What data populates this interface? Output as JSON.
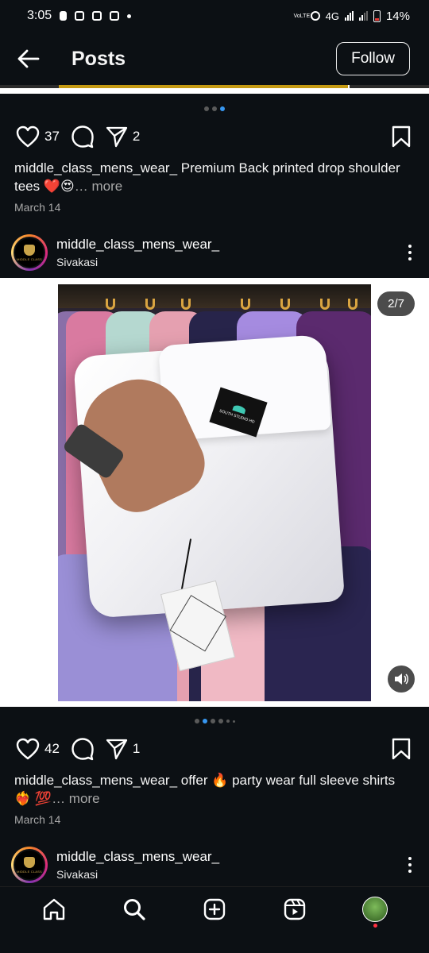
{
  "status_bar": {
    "time": "3:05",
    "network": "VoLTE1",
    "signal_label": "4G",
    "battery": "14%"
  },
  "header": {
    "title": "Posts",
    "follow_label": "Follow"
  },
  "post1": {
    "likes": "37",
    "shares": "2",
    "username": "middle_class_mens_wear_",
    "caption_text": "Premium Back printed drop shoulder tees ❤️😍",
    "more_label": "… more",
    "date": "March 14"
  },
  "post2": {
    "username": "middle_class_mens_wear_",
    "location": "Sivakasi",
    "counter": "2/7",
    "avatar_text": "MIDDLE CLASS",
    "label_text": "SOUTH STUDIO HD",
    "likes": "42",
    "shares": "1",
    "caption_text": "offer 🔥 party wear full sleeve shirts ❤️‍🔥 💯",
    "more_label": "… more",
    "date": "March 14"
  },
  "post3": {
    "username": "middle_class_mens_wear_",
    "location": "Sivakasi",
    "avatar_text": "MIDDLE CLASS"
  },
  "colors": {
    "background": "#0c1014",
    "accent_dot": "#3797f0",
    "muted_text": "#a8a8a8",
    "notification": "#ff3040"
  },
  "icons": {
    "back": "arrow-left-icon",
    "like": "heart-icon",
    "comment": "comment-bubble-icon",
    "share": "paper-plane-icon",
    "save": "bookmark-icon",
    "more": "kebab-icon",
    "sound": "speaker-icon",
    "home": "home-icon",
    "search": "search-icon",
    "create": "plus-square-icon",
    "reels": "reels-icon",
    "profile": "profile-avatar-icon"
  }
}
